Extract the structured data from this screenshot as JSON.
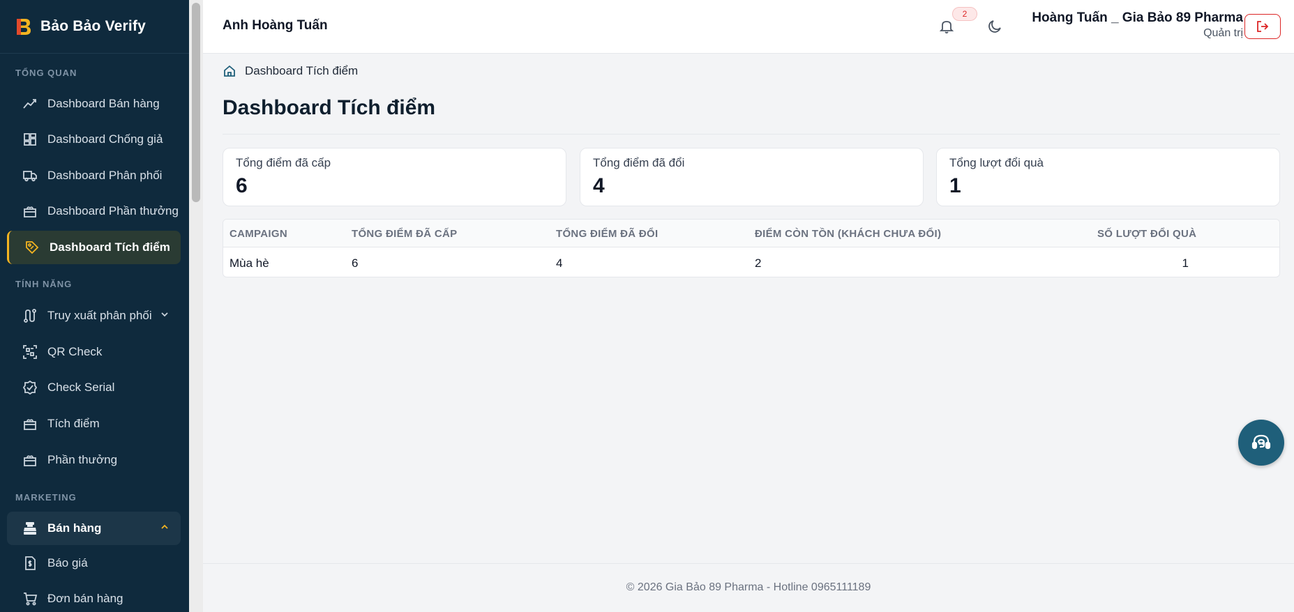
{
  "brand": {
    "name": "Bảo Bảo Verify"
  },
  "sidebar": {
    "sections": [
      {
        "label": "TỔNG QUAN"
      },
      {
        "label": "TÍNH NĂNG"
      },
      {
        "label": "MARKETING"
      }
    ],
    "items": [
      {
        "label": "Dashboard Bán hàng",
        "icon": "chart-line-icon"
      },
      {
        "label": "Dashboard Chống giả",
        "icon": "grid-layout-icon"
      },
      {
        "label": "Dashboard Phân phối",
        "icon": "truck-icon"
      },
      {
        "label": "Dashboard Phần thưởng",
        "icon": "gift-icon"
      },
      {
        "label": "Dashboard Tích điểm",
        "icon": "tag-icon",
        "active": true
      },
      {
        "label": "Truy xuất phân phối",
        "icon": "route-icon"
      },
      {
        "label": "QR Check",
        "icon": "qr-scan-icon"
      },
      {
        "label": "Check Serial",
        "icon": "badge-check-icon"
      },
      {
        "label": "Tích điểm",
        "icon": "gift-box-icon"
      },
      {
        "label": "Phần thưởng",
        "icon": "gift-box-icon"
      },
      {
        "label": "Bán hàng",
        "icon": "cash-register-icon",
        "open": true
      },
      {
        "label": "Báo giá",
        "icon": "invoice-icon"
      },
      {
        "label": "Đơn bán hàng",
        "icon": "cart-icon"
      }
    ]
  },
  "header": {
    "name": "Anh Hoàng Tuấn",
    "notification_count": "2",
    "user_name": "Hoàng Tuấn _ Gia Bảo 89 Pharma",
    "user_role": "Quản trị"
  },
  "breadcrumb": {
    "label": "Dashboard Tích điểm"
  },
  "page": {
    "title": "Dashboard Tích điểm"
  },
  "stats": [
    {
      "label": "Tổng điểm đã cấp",
      "value": "6"
    },
    {
      "label": "Tổng điểm đã đổi",
      "value": "4"
    },
    {
      "label": "Tổng lượt đổi quà",
      "value": "1"
    }
  ],
  "table": {
    "columns": [
      "CAMPAIGN",
      "TỔNG ĐIỂM ĐÃ CẤP",
      "TỔNG ĐIỂM ĐÃ ĐỔI",
      "ĐIỂM CÒN TỒN (KHÁCH CHƯA ĐỔI)",
      "SỐ LƯỢT ĐỔI QUÀ"
    ],
    "rows": [
      [
        "Mùa hè",
        "6",
        "4",
        "2",
        "1"
      ]
    ]
  },
  "footer": {
    "text": "© 2026 Gia Bảo 89 Pharma - Hotline 0965111189"
  },
  "colors": {
    "sidebar_bg": "#0f2a3d",
    "accent": "#f3b421",
    "danger": "#dc2626",
    "support_bg": "#1f5f7a"
  }
}
